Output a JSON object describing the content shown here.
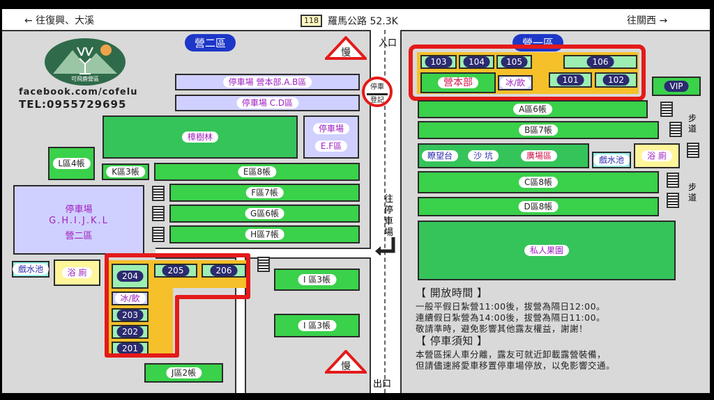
{
  "top_road": {
    "left_direction": "← 往復興、大溪",
    "route_number": "118",
    "route_label": "羅馬公路  52.3K",
    "right_direction": "往關西 →"
  },
  "signs": {
    "entrance": "入口",
    "exit": "出口",
    "slow": "慢",
    "parking_register_top": "停車",
    "parking_register_bottom": "登記",
    "to_parking_vertical": "往停車場"
  },
  "zones": {
    "zone2_title": "營二區",
    "zone1_title": "營一區"
  },
  "brand": {
    "logo_text": "可飛鹿營區",
    "facebook": "facebook.com/cofelu",
    "tel": "TEL:0955729695"
  },
  "areas": {
    "parking_ab": "停車場 營本部.A.B區",
    "parking_cd": "停車場  C.D區",
    "camphor": "樟樹林",
    "parking_ef_1": "停車場",
    "parking_ef_2": "E.F區",
    "l4": "L區4帳",
    "k3": "K區3帳",
    "e8": "E區8帳",
    "f7": "F區7帳",
    "g6": "G區6帳",
    "h7": "H區7帳",
    "parking_ghijkl_1": "停車場",
    "parking_ghijkl_2": "G.H.I.J.K.L",
    "parking_ghijkl_3": "營二區",
    "pool_left": "戲水池",
    "toilet_left": "浴 廁",
    "i3_a": "I 區3帳",
    "i3_b": "I 區3帳",
    "j2": "J區2帳",
    "r204": "204",
    "r205": "205",
    "r206": "206",
    "ice2": "冰/飲",
    "r203": "203",
    "r202": "202",
    "r201": "201",
    "r103": "103",
    "r104": "104",
    "r105": "105",
    "r106": "106",
    "hq": "營本部",
    "ice1": "冰/飲",
    "r101": "101",
    "r102": "102",
    "vip": "VIP",
    "a6": "A區6帳",
    "b7": "B區7帳",
    "lookout": "瞭望台",
    "sandpit": "沙 坑",
    "plaza": "廣場區",
    "pool_right": "戲水池",
    "toilet_right": "浴 廁",
    "c8": "C區8帳",
    "d8": "D區8帳",
    "orchard": "私人果園",
    "walkway": "步道"
  },
  "info": {
    "hours_title": "【 開放時間 】",
    "hours_1": "一般平假日紮營11:00後，拔營為隔日12:00。",
    "hours_2": "連續假日紮營為14:00後，拔營為隔日11:00。",
    "hours_3": "敬請準時，避免影響其他露友權益，謝謝！",
    "parking_title": "【 停車須知 】",
    "parking_1": "本營區採人車分離，露友可就近卸載露營裝備，",
    "parking_2": "但請儘速將愛車移置停車場停放，以免影響交通。"
  },
  "colors": {
    "tent_green": "#3ad14b",
    "red_frame": "#e41a1a",
    "zone_title_blue": "#1d37c8",
    "orange_deck": "#f5c02a"
  }
}
